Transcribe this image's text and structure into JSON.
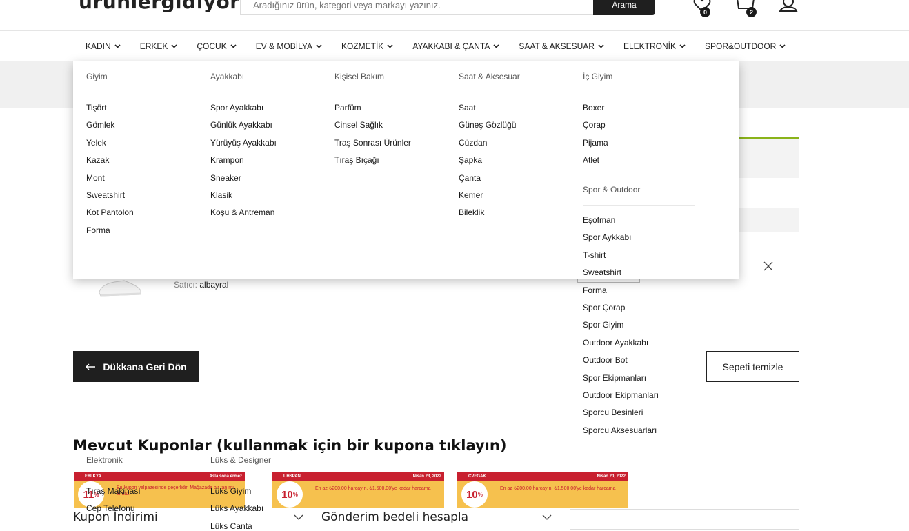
{
  "header": {
    "logo": "urunlergidiyor",
    "search_placeholder": "Aradığınız ürün, kategori veya markayı yazınız.",
    "search_button": "Arama",
    "wishlist_count": "0",
    "cart_count": "2"
  },
  "nav": [
    "KADIN",
    "ERKEK",
    "ÇOCUK",
    "EV & MOBİLYA",
    "KOZMETİK",
    "AYAKKABI & ÇANTA",
    "SAAT & AKSESUAR",
    "ELEKTRONİK",
    "SPOR&OUTDOOR"
  ],
  "mega_menu": {
    "giyim": {
      "title": "Giyim",
      "items": [
        "Tişört",
        "Gömlek",
        "Yelek",
        "Kazak",
        "Mont",
        "Sweatshirt",
        "Kot Pantolon",
        "Forma"
      ]
    },
    "ayakkabi": {
      "title": "Ayakkabı",
      "items": [
        "Spor Ayakkabı",
        "Günlük Ayakkabı",
        "Yürüyüş Ayakkabı",
        "Krampon",
        "Sneaker",
        "Klasik",
        "Koşu & Antreman"
      ]
    },
    "kisisel": {
      "title": "Kişisel Bakım",
      "items": [
        "Parfüm",
        "Cinsel Sağlık",
        "Traş Sonrası Ürünler",
        "Tıraş Bıçağı"
      ]
    },
    "saat": {
      "title": "Saat & Aksesuar",
      "items": [
        "Saat",
        "Güneş Gözlüğü",
        "Cüzdan",
        "Şapka",
        "Çanta",
        "Kemer",
        "Bileklik"
      ]
    },
    "icgiyim": {
      "title": "İç Giyim",
      "items": [
        "Boxer",
        "Çorap",
        "Pijama",
        "Atlet"
      ]
    },
    "spor": {
      "title": "Spor & Outdoor",
      "items": [
        "Eşofman",
        "Spor Aykkabı",
        "T-shirt",
        "Sweatshirt",
        "Forma",
        "Spor Çorap",
        "Spor Giyim",
        "Outdoor Ayakkabı",
        "Outdoor Bot",
        "Spor Ekipmanları",
        "Outdoor Ekipmanları",
        "Sporcu Besinleri",
        "Sporcu Aksesuarları"
      ]
    },
    "elektronik": {
      "title": "Elektronik",
      "items": [
        "Tıraş Makinası",
        "Cep Telefonu"
      ]
    },
    "luks": {
      "title": "Lüks & Designer",
      "items": [
        "Lüks Giyim",
        "Lüks Ayakkabı",
        "Lüks Canta"
      ]
    }
  },
  "cart": {
    "seller_label": "Satıcı:",
    "seller_name": "albayral",
    "back_button": "Dükkana Geri Dön",
    "clear_button": "Sepeti temizle"
  },
  "coupons": {
    "title": "Mevcut Kuponlar (kullanmak için bir kupona tıklayın)",
    "items": [
      {
        "code": "EYLKYA",
        "expiry": "Asla sona ermez",
        "value": "11",
        "unit": "%",
        "desc": "Bu kupon yelpazesinde geçerlidir. Mağazada bir tanımı",
        "desc2": "almaz"
      },
      {
        "code": "UHSPAN",
        "expiry": "Nisan 23, 2022",
        "value": "10",
        "unit": "%",
        "desc": "En az ₺200,00 harcayın. ₺1.500,00'ye kadar harcama",
        "desc2": ""
      },
      {
        "code": "CVEGAK",
        "expiry": "Nisan 20, 2022",
        "value": "10",
        "unit": "%",
        "desc": "En az ₺200,00 harcayın. ₺1.500,00'ye kadar harcama",
        "desc2": ""
      }
    ]
  },
  "accordions": {
    "coupon": "Kupon İndirimi",
    "shipping": "Gönderim bedeli hesapla"
  },
  "colors": {
    "accent_green": "#8ab31a",
    "coupon_red": "#c8202f",
    "coupon_yellow": "#f6c14e",
    "dark": "#1f1f1f"
  }
}
